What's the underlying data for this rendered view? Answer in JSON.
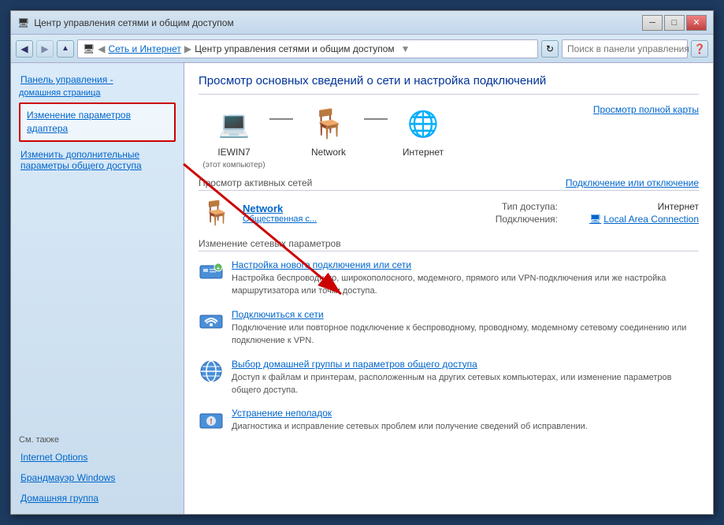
{
  "window": {
    "title": "Центр управления сетями и общим доступом",
    "controls": {
      "minimize": "─",
      "maximize": "□",
      "close": "✕"
    }
  },
  "addressbar": {
    "breadcrumbs": [
      "Сеть и Интернет",
      "Центр управления сетями и общим доступом"
    ],
    "search_placeholder": "Поиск в панели управления"
  },
  "sidebar": {
    "home_label": "Панель управления -",
    "home_sub": "домашняя страница",
    "highlighted_item": "Изменение параметров адаптера",
    "link2": "Изменить дополнительные параметры общего доступа",
    "see_also": "См. также",
    "also_items": [
      "Internet Options",
      "Брандмауэр Windows",
      "Домашняя группа"
    ]
  },
  "content": {
    "title": "Просмотр основных сведений о сети и настройка подключений",
    "view_full_map": "Просмотр полной карты",
    "network_icons": [
      {
        "label": "IEWIN7",
        "sub": "(этот компьютер)",
        "icon": "💻"
      },
      {
        "label": "Network",
        "sub": "",
        "icon": "🪑"
      },
      {
        "label": "Интернет",
        "sub": "",
        "icon": "🌐"
      }
    ],
    "active_networks_label": "Просмотр активных сетей",
    "connect_disconnect": "Подключение или отключение",
    "network": {
      "name": "Network",
      "type": "Общественная с...",
      "access_label": "Тип доступа:",
      "access_value": "Интернет",
      "connections_label": "Подключения:",
      "connections_value": "Local Area Connection"
    },
    "change_settings_label": "Изменение сетевых параметров",
    "settings": [
      {
        "icon": "⚙",
        "link": "Настройка нового подключения или сети",
        "desc": "Настройка беспроводного, широкополосного, модемного, прямого или VPN-подключения или же настройка маршрутизатора или точки доступа."
      },
      {
        "icon": "⚙",
        "link": "Подключиться к сети",
        "desc": "Подключение или повторное подключение к беспроводному, проводному, модемному сетевому соединению или подключение к VPN."
      },
      {
        "icon": "⚙",
        "link": "Выбор домашней группы и параметров общего доступа",
        "desc": "Доступ к файлам и принтерам, расположенным на других сетевых компьютерах, или изменение параметров общего доступа."
      },
      {
        "icon": "⚙",
        "link": "Устранение неполадок",
        "desc": "Диагностика и исправление сетевых проблем или получение сведений об исправлении."
      }
    ]
  }
}
